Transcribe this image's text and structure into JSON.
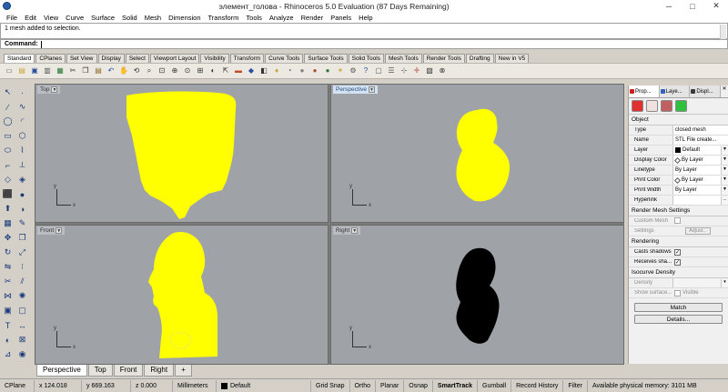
{
  "window": {
    "title": "элемент_голова - Rhinoceros 5.0 Evaluation (87 Days Remaining)",
    "minimize": "─",
    "maximize": "□",
    "close": "✕"
  },
  "menu": [
    "File",
    "Edit",
    "View",
    "Curve",
    "Surface",
    "Solid",
    "Mesh",
    "Dimension",
    "Transform",
    "Tools",
    "Analyze",
    "Render",
    "Panels",
    "Help"
  ],
  "command": {
    "history": "1 mesh added to selection.",
    "prompt": "Command:",
    "value": ""
  },
  "toolbar_tabs": [
    "Standard",
    "CPlanes",
    "Set View",
    "Display",
    "Select",
    "Viewport Layout",
    "Visibility",
    "Transform",
    "Curve Tools",
    "Surface Tools",
    "Solid Tools",
    "Mesh Tools",
    "Render Tools",
    "Drafting",
    "New in V5"
  ],
  "toolbar_icons": [
    {
      "name": "new-file-icon",
      "glyph": "▭",
      "color": "#6a6a6a"
    },
    {
      "name": "open-file-icon",
      "glyph": "▤",
      "color": "#c9a53a"
    },
    {
      "name": "save-icon",
      "glyph": "▣",
      "color": "#2a4f9e"
    },
    {
      "name": "print-icon",
      "glyph": "▥",
      "color": "#555"
    },
    {
      "name": "import-icon",
      "glyph": "▦",
      "color": "#2a7a3a"
    },
    {
      "name": "cut-icon",
      "glyph": "✂",
      "color": "#333"
    },
    {
      "name": "copy-icon",
      "glyph": "❐",
      "color": "#333"
    },
    {
      "name": "paste-icon",
      "glyph": "▤",
      "color": "#8a6a2a"
    },
    {
      "name": "undo-icon",
      "glyph": "↶",
      "color": "#2a4f9e"
    },
    {
      "name": "pan-icon",
      "glyph": "✋",
      "color": "#b8860b"
    },
    {
      "name": "rotate-view-icon",
      "glyph": "⟲",
      "color": "#333"
    },
    {
      "name": "zoom-icon",
      "glyph": "⌕",
      "color": "#333"
    },
    {
      "name": "zoom-window-icon",
      "glyph": "⊡",
      "color": "#333"
    },
    {
      "name": "zoom-extents-icon",
      "glyph": "⊕",
      "color": "#333"
    },
    {
      "name": "zoom-selected-icon",
      "glyph": "⊙",
      "color": "#333"
    },
    {
      "name": "viewport-4-icon",
      "glyph": "⊞",
      "color": "#333"
    },
    {
      "name": "hide-icon",
      "glyph": "◐",
      "color": "#333"
    },
    {
      "name": "select-all-icon",
      "glyph": "⇱",
      "color": "#333"
    },
    {
      "name": "lock-icon",
      "glyph": "▬",
      "color": "#c04a2a"
    },
    {
      "name": "layer-icon",
      "glyph": "◆",
      "color": "#2a4f9e"
    },
    {
      "name": "object-props-icon",
      "glyph": "◧",
      "color": "#333"
    },
    {
      "name": "bulb-icon",
      "glyph": "♦",
      "color": "#c9a53a"
    },
    {
      "name": "shaded-icon",
      "glyph": "◔",
      "color": "#555"
    },
    {
      "name": "render-sphere-icon",
      "glyph": "●",
      "color": "#808080"
    },
    {
      "name": "rendered-sphere-icon",
      "glyph": "●",
      "color": "#b04a3a"
    },
    {
      "name": "material-sphere-icon",
      "glyph": "●",
      "color": "#2a7a3a"
    },
    {
      "name": "light-icon",
      "glyph": "✶",
      "color": "#c9a53a"
    },
    {
      "name": "settings-icon",
      "glyph": "⚙",
      "color": "#555"
    },
    {
      "name": "help-icon",
      "glyph": "?",
      "color": "#2a4f9e"
    },
    {
      "name": "properties-icon",
      "glyph": "▢",
      "color": "#555"
    },
    {
      "name": "options-icon",
      "glyph": "☰",
      "color": "#555"
    },
    {
      "name": "grid-snap-icon",
      "glyph": "⊹",
      "color": "#555"
    },
    {
      "name": "gumball-icon",
      "glyph": "✛",
      "color": "#b04a3a"
    },
    {
      "name": "mesh-icon",
      "glyph": "▧",
      "color": "#333"
    },
    {
      "name": "osnap-icon",
      "glyph": "⊗",
      "color": "#333"
    }
  ],
  "left_tools": [
    {
      "name": "select-arrow-icon",
      "glyph": "↖"
    },
    {
      "name": "point-icon",
      "glyph": "·"
    },
    {
      "name": "polyline-icon",
      "glyph": "∕"
    },
    {
      "name": "curve-icon",
      "glyph": "∿"
    },
    {
      "name": "circle-icon",
      "glyph": "◯"
    },
    {
      "name": "arc-icon",
      "glyph": "◜"
    },
    {
      "name": "rectangle-icon",
      "glyph": "▭"
    },
    {
      "name": "polygon-icon",
      "glyph": "⬡"
    },
    {
      "name": "ellipse-icon",
      "glyph": "⬭"
    },
    {
      "name": "freeform-icon",
      "glyph": "⌇"
    },
    {
      "name": "fillet-icon",
      "glyph": "⌐"
    },
    {
      "name": "offset-icon",
      "glyph": "⟂"
    },
    {
      "name": "surface-icon",
      "glyph": "◇"
    },
    {
      "name": "loft-icon",
      "glyph": "◈"
    },
    {
      "name": "box-icon",
      "glyph": "⬛"
    },
    {
      "name": "sphere-icon",
      "glyph": "●"
    },
    {
      "name": "extrude-icon",
      "glyph": "⬆"
    },
    {
      "name": "boolean-icon",
      "glyph": "◑"
    },
    {
      "name": "mesh-tool-icon",
      "glyph": "▦"
    },
    {
      "name": "paint-icon",
      "glyph": "✎"
    },
    {
      "name": "move-icon",
      "glyph": "✥"
    },
    {
      "name": "copy-tool-icon",
      "glyph": "❐"
    },
    {
      "name": "rotate-icon",
      "glyph": "↻"
    },
    {
      "name": "scale-icon",
      "glyph": "⤢"
    },
    {
      "name": "mirror-icon",
      "glyph": "⇋"
    },
    {
      "name": "array-icon",
      "glyph": "⁝"
    },
    {
      "name": "trim-icon",
      "glyph": "✂"
    },
    {
      "name": "split-icon",
      "glyph": "⫽"
    },
    {
      "name": "join-icon",
      "glyph": "⋈"
    },
    {
      "name": "explode-icon",
      "glyph": "✺"
    },
    {
      "name": "group-icon",
      "glyph": "▣"
    },
    {
      "name": "ungroup-icon",
      "glyph": "▢"
    },
    {
      "name": "text-icon",
      "glyph": "T"
    },
    {
      "name": "dimension-icon",
      "glyph": "↔"
    },
    {
      "name": "hide-tool-icon",
      "glyph": "◐"
    },
    {
      "name": "lock-tool-icon",
      "glyph": "⊠"
    },
    {
      "name": "analyze-icon",
      "glyph": "⊿"
    },
    {
      "name": "render-tool-icon",
      "glyph": "◉"
    }
  ],
  "viewports": {
    "top": {
      "label": "Top"
    },
    "perspective": {
      "label": "Perspective"
    },
    "front": {
      "label": "Front"
    },
    "right": {
      "label": "Right"
    },
    "axis_x": "x",
    "axis_y": "y"
  },
  "viewport_tabs": [
    "Perspective",
    "Top",
    "Front",
    "Right",
    "+"
  ],
  "panel": {
    "tabs": [
      "Prop...",
      "Laye...",
      "Displ..."
    ],
    "section_object": "Object",
    "rows": [
      {
        "key": "Type",
        "value": "closed mesh"
      },
      {
        "key": "Name",
        "value": "STL File create..."
      },
      {
        "key": "Layer",
        "value": "Default"
      },
      {
        "key": "Display Color",
        "value": "By Layer"
      },
      {
        "key": "Linetype",
        "value": "By Layer"
      },
      {
        "key": "Print Color",
        "value": "By Layer"
      },
      {
        "key": "Print Width",
        "value": "By Layer"
      },
      {
        "key": "Hyperlink",
        "value": ""
      }
    ],
    "section_render_mesh": "Render Mesh Settings",
    "custom_mesh": "Custom Mesh",
    "settings": "Settings",
    "adjust": "Adjust...",
    "section_rendering": "Rendering",
    "casts_shadows": "Casts shadows",
    "receives_shadows": "Receives sha...",
    "section_isocurve": "Isocurve Density",
    "density": "Density",
    "show_surface": "Show surface...",
    "visible": "Visible",
    "match": "Match",
    "details": "Details...",
    "ellipsis": "..."
  },
  "status": {
    "cplane": "CPlane",
    "x": "x 124.018",
    "y": "y 669.163",
    "z": "z 0.000",
    "units": "Millimeters",
    "layer": "Default",
    "grid_snap": "Grid Snap",
    "ortho": "Ortho",
    "planar": "Planar",
    "osnap": "Osnap",
    "smarttrack": "SmartTrack",
    "gumball": "Gumball",
    "record_history": "Record History",
    "filter": "Filter",
    "memory": "Available physical memory: 3101 MB"
  },
  "colors": {
    "mesh_yellow": "#ffff00",
    "mesh_black": "#000000",
    "viewport_bg": "#9fa3a8"
  }
}
